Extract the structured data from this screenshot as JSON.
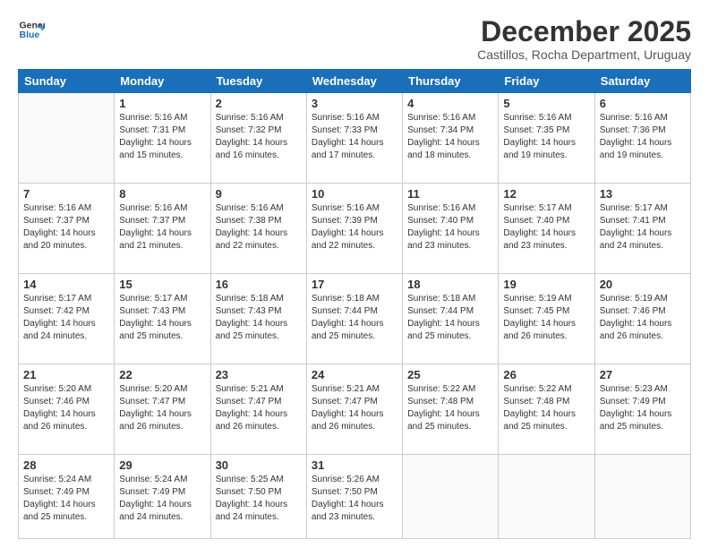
{
  "logo": {
    "line1": "General",
    "line2": "Blue"
  },
  "title": "December 2025",
  "subtitle": "Castillos, Rocha Department, Uruguay",
  "days_header": [
    "Sunday",
    "Monday",
    "Tuesday",
    "Wednesday",
    "Thursday",
    "Friday",
    "Saturday"
  ],
  "weeks": [
    [
      {
        "day": "",
        "info": ""
      },
      {
        "day": "1",
        "info": "Sunrise: 5:16 AM\nSunset: 7:31 PM\nDaylight: 14 hours\nand 15 minutes."
      },
      {
        "day": "2",
        "info": "Sunrise: 5:16 AM\nSunset: 7:32 PM\nDaylight: 14 hours\nand 16 minutes."
      },
      {
        "day": "3",
        "info": "Sunrise: 5:16 AM\nSunset: 7:33 PM\nDaylight: 14 hours\nand 17 minutes."
      },
      {
        "day": "4",
        "info": "Sunrise: 5:16 AM\nSunset: 7:34 PM\nDaylight: 14 hours\nand 18 minutes."
      },
      {
        "day": "5",
        "info": "Sunrise: 5:16 AM\nSunset: 7:35 PM\nDaylight: 14 hours\nand 19 minutes."
      },
      {
        "day": "6",
        "info": "Sunrise: 5:16 AM\nSunset: 7:36 PM\nDaylight: 14 hours\nand 19 minutes."
      }
    ],
    [
      {
        "day": "7",
        "info": "Sunrise: 5:16 AM\nSunset: 7:37 PM\nDaylight: 14 hours\nand 20 minutes."
      },
      {
        "day": "8",
        "info": "Sunrise: 5:16 AM\nSunset: 7:37 PM\nDaylight: 14 hours\nand 21 minutes."
      },
      {
        "day": "9",
        "info": "Sunrise: 5:16 AM\nSunset: 7:38 PM\nDaylight: 14 hours\nand 22 minutes."
      },
      {
        "day": "10",
        "info": "Sunrise: 5:16 AM\nSunset: 7:39 PM\nDaylight: 14 hours\nand 22 minutes."
      },
      {
        "day": "11",
        "info": "Sunrise: 5:16 AM\nSunset: 7:40 PM\nDaylight: 14 hours\nand 23 minutes."
      },
      {
        "day": "12",
        "info": "Sunrise: 5:17 AM\nSunset: 7:40 PM\nDaylight: 14 hours\nand 23 minutes."
      },
      {
        "day": "13",
        "info": "Sunrise: 5:17 AM\nSunset: 7:41 PM\nDaylight: 14 hours\nand 24 minutes."
      }
    ],
    [
      {
        "day": "14",
        "info": "Sunrise: 5:17 AM\nSunset: 7:42 PM\nDaylight: 14 hours\nand 24 minutes."
      },
      {
        "day": "15",
        "info": "Sunrise: 5:17 AM\nSunset: 7:43 PM\nDaylight: 14 hours\nand 25 minutes."
      },
      {
        "day": "16",
        "info": "Sunrise: 5:18 AM\nSunset: 7:43 PM\nDaylight: 14 hours\nand 25 minutes."
      },
      {
        "day": "17",
        "info": "Sunrise: 5:18 AM\nSunset: 7:44 PM\nDaylight: 14 hours\nand 25 minutes."
      },
      {
        "day": "18",
        "info": "Sunrise: 5:18 AM\nSunset: 7:44 PM\nDaylight: 14 hours\nand 25 minutes."
      },
      {
        "day": "19",
        "info": "Sunrise: 5:19 AM\nSunset: 7:45 PM\nDaylight: 14 hours\nand 26 minutes."
      },
      {
        "day": "20",
        "info": "Sunrise: 5:19 AM\nSunset: 7:46 PM\nDaylight: 14 hours\nand 26 minutes."
      }
    ],
    [
      {
        "day": "21",
        "info": "Sunrise: 5:20 AM\nSunset: 7:46 PM\nDaylight: 14 hours\nand 26 minutes."
      },
      {
        "day": "22",
        "info": "Sunrise: 5:20 AM\nSunset: 7:47 PM\nDaylight: 14 hours\nand 26 minutes."
      },
      {
        "day": "23",
        "info": "Sunrise: 5:21 AM\nSunset: 7:47 PM\nDaylight: 14 hours\nand 26 minutes."
      },
      {
        "day": "24",
        "info": "Sunrise: 5:21 AM\nSunset: 7:47 PM\nDaylight: 14 hours\nand 26 minutes."
      },
      {
        "day": "25",
        "info": "Sunrise: 5:22 AM\nSunset: 7:48 PM\nDaylight: 14 hours\nand 25 minutes."
      },
      {
        "day": "26",
        "info": "Sunrise: 5:22 AM\nSunset: 7:48 PM\nDaylight: 14 hours\nand 25 minutes."
      },
      {
        "day": "27",
        "info": "Sunrise: 5:23 AM\nSunset: 7:49 PM\nDaylight: 14 hours\nand 25 minutes."
      }
    ],
    [
      {
        "day": "28",
        "info": "Sunrise: 5:24 AM\nSunset: 7:49 PM\nDaylight: 14 hours\nand 25 minutes."
      },
      {
        "day": "29",
        "info": "Sunrise: 5:24 AM\nSunset: 7:49 PM\nDaylight: 14 hours\nand 24 minutes."
      },
      {
        "day": "30",
        "info": "Sunrise: 5:25 AM\nSunset: 7:50 PM\nDaylight: 14 hours\nand 24 minutes."
      },
      {
        "day": "31",
        "info": "Sunrise: 5:26 AM\nSunset: 7:50 PM\nDaylight: 14 hours\nand 23 minutes."
      },
      {
        "day": "",
        "info": ""
      },
      {
        "day": "",
        "info": ""
      },
      {
        "day": "",
        "info": ""
      }
    ]
  ]
}
